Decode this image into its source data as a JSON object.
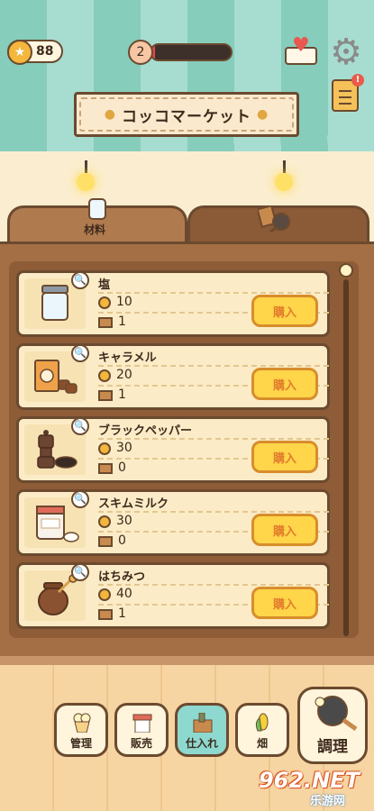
{
  "hud": {
    "coins": "88",
    "level": "2",
    "level_progress": 0.05
  },
  "sign": {
    "title": "コッコマーケット"
  },
  "tabs": [
    {
      "label": "材料"
    },
    {
      "label": ""
    }
  ],
  "items": [
    {
      "name": "塩",
      "price": "10",
      "owned": "1",
      "buy_label": "購入",
      "icon": "salt-jar-icon"
    },
    {
      "name": "キャラメル",
      "price": "20",
      "owned": "1",
      "buy_label": "購入",
      "icon": "caramel-box-icon"
    },
    {
      "name": "ブラックペッパー",
      "price": "30",
      "owned": "0",
      "buy_label": "購入",
      "icon": "pepper-mill-icon"
    },
    {
      "name": "スキムミルク",
      "price": "30",
      "owned": "0",
      "buy_label": "購入",
      "icon": "milk-can-icon"
    },
    {
      "name": "はちみつ",
      "price": "40",
      "owned": "1",
      "buy_label": "購入",
      "icon": "honey-pot-icon"
    }
  ],
  "nav": [
    {
      "label": "管理",
      "icon": "popcorn-icon"
    },
    {
      "label": "販売",
      "icon": "shop-icon"
    },
    {
      "label": "仕入れ",
      "icon": "crate-icon"
    },
    {
      "label": "畑",
      "icon": "corn-icon"
    },
    {
      "label": "調理",
      "icon": "frying-pan-icon"
    }
  ],
  "watermark": {
    "brand": "962.NET",
    "sub": "乐游网"
  },
  "colors": {
    "awning_teal": "#86cdbb",
    "wood": "#a56f45",
    "card_bg": "#fbecc7",
    "buy_yellow": "#ffd54a",
    "buy_text": "#e27d2b",
    "outline": "#6b4a2f"
  }
}
